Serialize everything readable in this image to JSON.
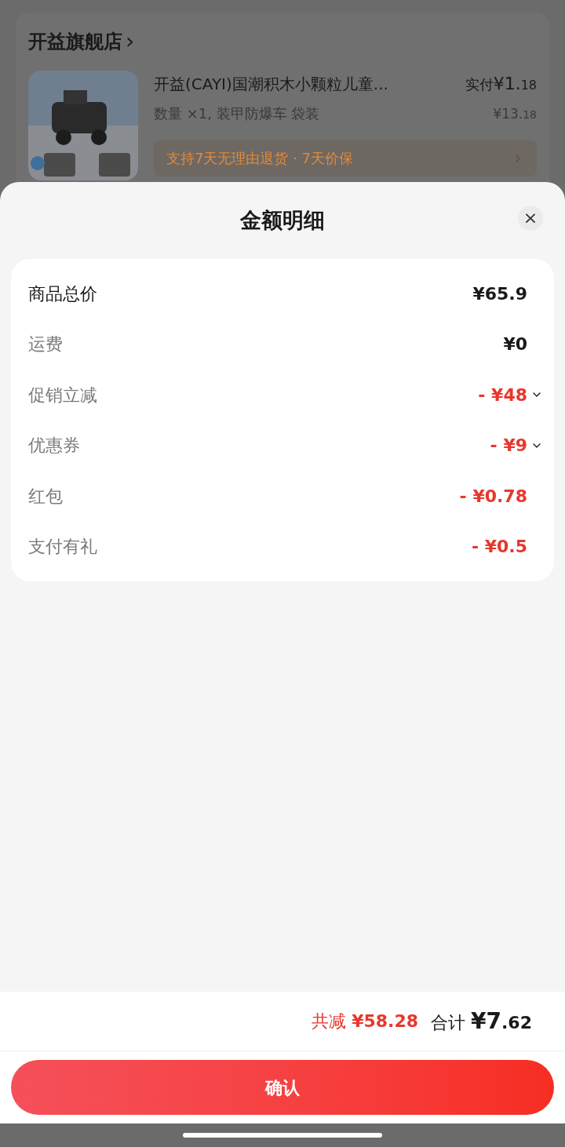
{
  "store": {
    "name": "开益旗舰店",
    "chevron": "›"
  },
  "product": {
    "title": "开益(CAYI)国潮积木小颗粒儿童...",
    "pay_label": "实付",
    "pay_main": "¥1.",
    "pay_fraction": "18",
    "variant": "数量 ×1, 装甲防爆车 袋装",
    "price_main": "¥13.",
    "price_fraction": "18",
    "service": "支持7天无理由退货 · 7天价保"
  },
  "sheet": {
    "title": "金额明细",
    "close": "×"
  },
  "rows": [
    {
      "kind": "total",
      "label": "商品总价",
      "value": "¥65.9",
      "expandable": false
    },
    {
      "kind": "charge",
      "label": "运费",
      "value": "¥0",
      "expandable": false
    },
    {
      "kind": "discount",
      "label": "促销立减",
      "value": "- ¥48",
      "expandable": true
    },
    {
      "kind": "discount",
      "label": "优惠券",
      "value": "- ¥9",
      "expandable": true
    },
    {
      "kind": "discount",
      "label": "红包",
      "value": "- ¥0.78",
      "expandable": false
    },
    {
      "kind": "discount",
      "label": "支付有礼",
      "value": "- ¥0.5",
      "expandable": false
    }
  ],
  "summary": {
    "saved_label": "共减",
    "saved_value": "¥58.28",
    "total_label": "合计",
    "total_main": "¥7",
    "total_fraction": ".62"
  },
  "confirm": "确认"
}
